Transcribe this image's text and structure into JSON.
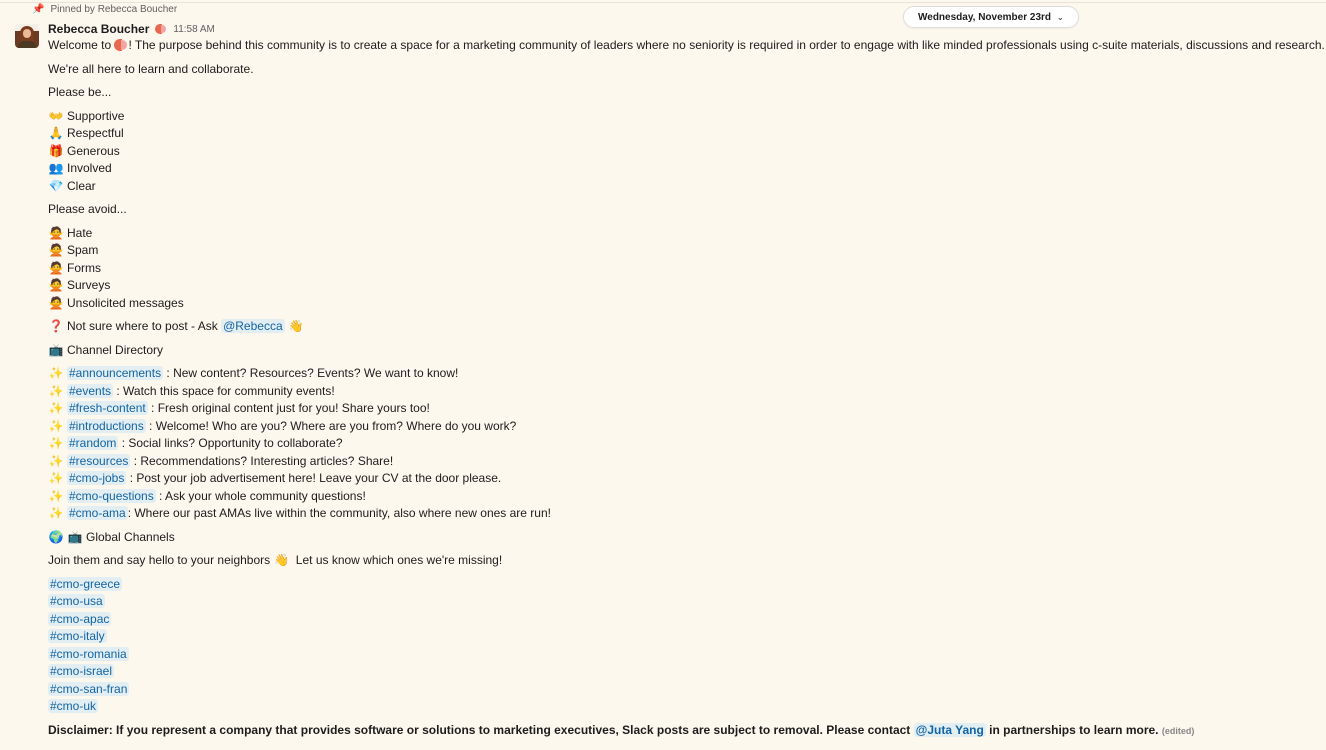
{
  "pinned": {
    "icon": "pin-icon",
    "text": "Pinned by Rebecca Boucher"
  },
  "date_divider": {
    "label": "Wednesday, November 23rd",
    "icon": "chevron-down-icon"
  },
  "message": {
    "author": "Rebecca Boucher",
    "time": "11:58 AM",
    "intro_prefix": "Welcome to ",
    "intro_suffix": "! The purpose behind this community is to create a space for a marketing community of leaders where no seniority is required in order to engage with like minded professionals using c-suite materials, discussions and research.",
    "learn_line": "We're all here to learn and collaborate.",
    "please_be_heading": "Please be...",
    "please_be": [
      {
        "emoji": "👐",
        "icon": "open-hands-icon",
        "label": "Supportive"
      },
      {
        "emoji": "🙏",
        "icon": "folded-hands-icon",
        "label": "Respectful"
      },
      {
        "emoji": "🎁",
        "icon": "gift-icon",
        "label": "Generous"
      },
      {
        "emoji": "👥",
        "icon": "people-icon",
        "label": "Involved"
      },
      {
        "emoji": "💎",
        "icon": "gem-icon",
        "label": "Clear"
      }
    ],
    "please_avoid_heading": "Please avoid...",
    "please_avoid": [
      {
        "emoji": "🙅",
        "icon": "no-gesture-icon",
        "label": "Hate"
      },
      {
        "emoji": "🙅",
        "icon": "no-gesture-icon",
        "label": "Spam"
      },
      {
        "emoji": "🙅",
        "icon": "no-gesture-icon",
        "label": "Forms"
      },
      {
        "emoji": "🙅",
        "icon": "no-gesture-icon",
        "label": "Surveys"
      },
      {
        "emoji": "🙅",
        "icon": "no-gesture-icon",
        "label": "Unsolicited messages"
      }
    ],
    "not_sure": {
      "emoji": "❓",
      "text": "Not sure where to post - Ask ",
      "mention": "@Rebecca",
      "wave": "👋"
    },
    "channel_directory": {
      "emoji": "📺",
      "label": "Channel Directory"
    },
    "channels": [
      {
        "emoji": "✨",
        "name": "#announcements",
        "desc": " : New content? Resources? Events? We want to know!"
      },
      {
        "emoji": "✨",
        "name": "#events",
        "desc": " : Watch this space for community events!"
      },
      {
        "emoji": "✨",
        "name": "#fresh-content",
        "desc": " : Fresh original content just for you! Share yours too!"
      },
      {
        "emoji": "✨",
        "name": "#introductions",
        "desc": " : Welcome! Who are you? Where are you from? Where do you work?"
      },
      {
        "emoji": "✨",
        "name": "#random",
        "desc": " : Social links? Opportunity to collaborate?"
      },
      {
        "emoji": "✨",
        "name": "#resources",
        "desc": " : Recommendations? Interesting articles? Share!"
      },
      {
        "emoji": "✨",
        "name": "#cmo-jobs",
        "desc": " : Post your job advertisement here! Leave your CV at the door please."
      },
      {
        "emoji": "✨",
        "name": "#cmo-questions",
        "desc": " : Ask your whole community questions!"
      },
      {
        "emoji": "✨",
        "name": "#cmo-ama",
        "desc": ": Where our past AMAs live within the community, also where new ones are run!"
      }
    ],
    "global": {
      "emoji1": "🌍",
      "emoji2": "📺",
      "label": "Global Channels"
    },
    "join_line": {
      "before": "Join them and say hello to your neighbors ",
      "wave": "👋",
      "after": " Let us know which ones we're missing!"
    },
    "global_channels": [
      "#cmo-greece",
      "#cmo-usa",
      "#cmo-apac",
      "#cmo-italy",
      "#cmo-romania",
      "#cmo-israel",
      "#cmo-san-fran",
      "#cmo-uk"
    ],
    "disclaimer": {
      "before": "Disclaimer: If you represent a company that provides software or solutions to marketing executives, Slack posts are subject to removal. Please contact ",
      "mention": "@Juta Yang",
      "after": " in partnerships to learn more.",
      "edited": "(edited)"
    }
  },
  "colors": {
    "background": "#fdf8ed",
    "link": "#1264a3",
    "mention_bg": "#e3eef2",
    "pin": "#e8912d"
  }
}
